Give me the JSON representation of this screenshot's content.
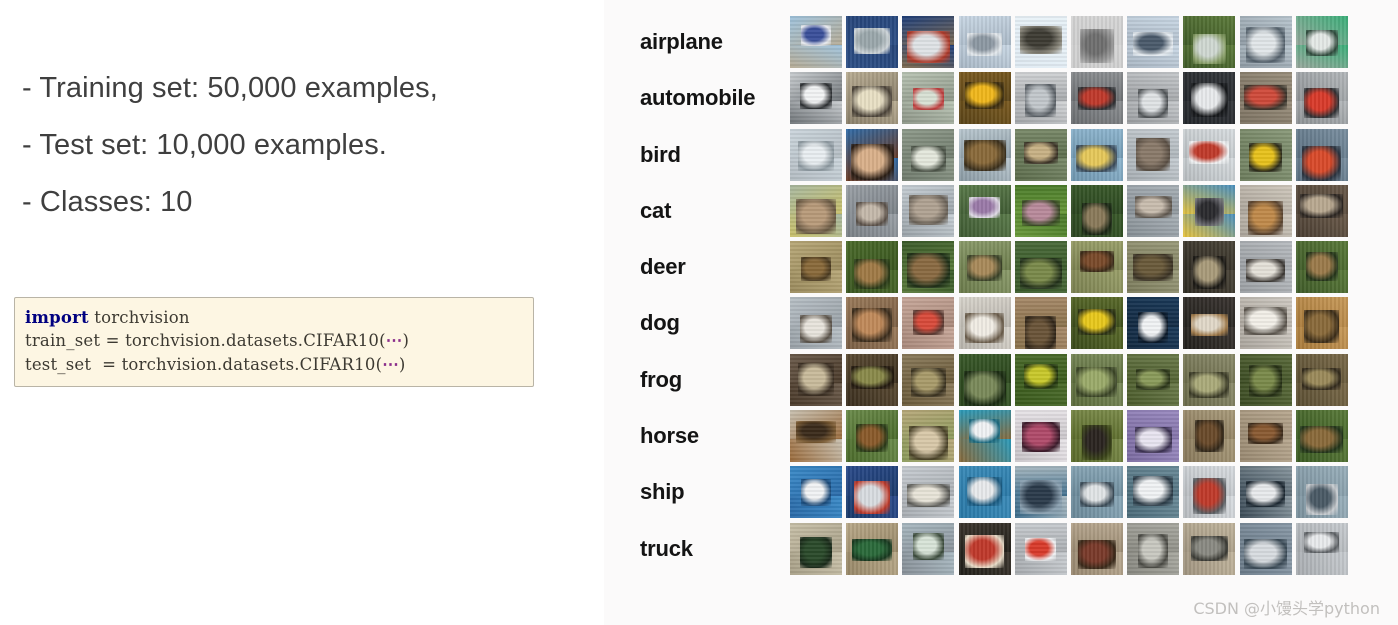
{
  "slide": {
    "bullets": [
      "- Training set: 50,000 examples,",
      "- Test set: 10,000 examples.",
      "- Classes: 10"
    ],
    "code": {
      "line1_keyword": "import",
      "line1_rest": " torchvision",
      "line2_pre": "train_set = torchvision.datasets.CIFAR10(",
      "line2_ellipsis": "⋯",
      "line2_post": ")",
      "line3_pre": "test_set  = torchvision.datasets.CIFAR10(",
      "line3_ellipsis": "⋯",
      "line3_post": ")"
    },
    "watermark": "CSDN @小馒头学python",
    "colors": {
      "text": "#3f3f3f",
      "code_bg": "#fdf6e3",
      "code_border": "#b9b4a6",
      "keyword": "#000080",
      "ellipsis": "#8b2f8b",
      "label": "#141414",
      "panel_bg": "#fbfafa",
      "watermark": "#c2c0be"
    }
  },
  "dataset_grid": {
    "columns": 10,
    "rows": [
      {
        "label": "airplane",
        "thumbs": [
          {
            "sky": "#9fc3dd",
            "ground": "#b6ab94",
            "obj": "#3a4f9a",
            "obj2": "#e8eaee"
          },
          {
            "sky": "#26457a",
            "ground": "#2d4f86",
            "obj": "#9aa7ab",
            "obj2": "#cdd4d8"
          },
          {
            "sky": "#1f3f7a",
            "ground": "#7e6a4e",
            "obj": "#dfe3e6",
            "obj2": "#b03a2a"
          },
          {
            "sky": "#c9d7e4",
            "ground": "#a9b8c6",
            "obj": "#8d98a3",
            "obj2": "#e3e8ec"
          },
          {
            "sky": "#e9f2f8",
            "ground": "#dfeaf2",
            "obj": "#3d3b33",
            "obj2": "#8d8a7e"
          },
          {
            "sky": "#d6d6d6",
            "ground": "#cfcfcf",
            "obj": "#6f6f6f",
            "obj2": "#9a9a9a"
          },
          {
            "sky": "#cbd9e6",
            "ground": "#a8b5c2",
            "obj": "#4a5a6b",
            "obj2": "#e6ecf1"
          },
          {
            "sky": "#5c7a3a",
            "ground": "#3f5a28",
            "obj": "#cfd8d2",
            "obj2": "#8aa06a"
          },
          {
            "sky": "#b9c6cf",
            "ground": "#8e9aa3",
            "obj": "#e1e6e9",
            "obj2": "#55626d"
          },
          {
            "sky": "#3bb07a",
            "ground": "#9aa79d",
            "obj": "#e4e9e6",
            "obj2": "#2f4a3c"
          }
        ]
      },
      {
        "label": "automobile",
        "thumbs": [
          {
            "sky": "#c9cdd0",
            "ground": "#6d7276",
            "obj": "#f2f3f4",
            "obj2": "#2b2e31"
          },
          {
            "sky": "#b8ac92",
            "ground": "#8a7f6a",
            "obj": "#e8dfc4",
            "obj2": "#4a4238"
          },
          {
            "sky": "#b9c4b4",
            "ground": "#8c9486",
            "obj": "#d8e0d4",
            "obj2": "#c03a3a"
          },
          {
            "sky": "#7a5a20",
            "ground": "#5a4418",
            "obj": "#f0b71c",
            "obj2": "#3a2c10"
          },
          {
            "sky": "#d2d4d6",
            "ground": "#a3a6a9",
            "obj": "#c2c7cb",
            "obj2": "#5a6066"
          },
          {
            "sky": "#8c8f92",
            "ground": "#6a6d70",
            "obj": "#c0392b",
            "obj2": "#2e3033"
          },
          {
            "sky": "#c5c8cb",
            "ground": "#9a9da0",
            "obj": "#dfe2e5",
            "obj2": "#4f5356"
          },
          {
            "sky": "#33363a",
            "ground": "#22252a",
            "obj": "#e8eaec",
            "obj2": "#15171a"
          },
          {
            "sky": "#9a8f7c",
            "ground": "#7a7060",
            "obj": "#cf4a3a",
            "obj2": "#3a352c"
          },
          {
            "sky": "#b4b8bb",
            "ground": "#8e9295",
            "obj": "#d93a2a",
            "obj2": "#2f3134"
          }
        ]
      },
      {
        "label": "bird",
        "thumbs": [
          {
            "sky": "#ccd6dd",
            "ground": "#b3bcc2",
            "obj": "#e9eef1",
            "obj2": "#8e9aa1"
          },
          {
            "sky": "#2f6ba8",
            "ground": "#6b3a22",
            "obj": "#d9b08a",
            "obj2": "#2a1d14"
          },
          {
            "sky": "#8e9a8a",
            "ground": "#6f7a6c",
            "obj": "#e4e8dc",
            "obj2": "#4a5246"
          },
          {
            "sky": "#b9c7cf",
            "ground": "#8a9aa3",
            "obj": "#8a6a3a",
            "obj2": "#3a2f1c"
          },
          {
            "sky": "#7a8a6a",
            "ground": "#5a6a4a",
            "obj": "#c7b184",
            "obj2": "#3a3226"
          },
          {
            "sky": "#8fb6cf",
            "ground": "#6f96af",
            "obj": "#e6c85a",
            "obj2": "#3a4a5a"
          },
          {
            "sky": "#c6cdd2",
            "ground": "#a6adb2",
            "obj": "#8a7a6a",
            "obj2": "#5a4f44"
          },
          {
            "sky": "#d8dde0",
            "ground": "#b8bdc0",
            "obj": "#c03a2a",
            "obj2": "#f0f2f3"
          },
          {
            "sky": "#8a9a7a",
            "ground": "#6a7a5a",
            "obj": "#e8c21c",
            "obj2": "#2a2a1a"
          },
          {
            "sky": "#7a8fa0",
            "ground": "#5a6f80",
            "obj": "#d94a2a",
            "obj2": "#2a3440"
          }
        ]
      },
      {
        "label": "cat",
        "thumbs": [
          {
            "sky": "#a8b8a0",
            "ground": "#c9c06a",
            "obj": "#b89a7a",
            "obj2": "#6a5a44"
          },
          {
            "sky": "#9aa0a6",
            "ground": "#7a8086",
            "obj": "#c4b8aa",
            "obj2": "#5a5048"
          },
          {
            "sky": "#c6ced4",
            "ground": "#9aa2a8",
            "obj": "#b0a292",
            "obj2": "#6a6258"
          },
          {
            "sky": "#5a7a4a",
            "ground": "#3f5a33",
            "obj": "#9a7aa8",
            "obj2": "#e0dce6"
          },
          {
            "sky": "#4a7a2a",
            "ground": "#6a9a3a",
            "obj": "#b88a9a",
            "obj2": "#3a4a26"
          },
          {
            "sky": "#3a5a2a",
            "ground": "#2a4420",
            "obj": "#8a7a5a",
            "obj2": "#1a2614"
          },
          {
            "sky": "#a8b0b6",
            "ground": "#868e94",
            "obj": "#c8bcae",
            "obj2": "#5f574e"
          },
          {
            "sky": "#4a90c0",
            "ground": "#e8c23a",
            "obj": "#2a2a2e",
            "obj2": "#6a6a70"
          },
          {
            "sky": "#cfc8bc",
            "ground": "#aaa399",
            "obj": "#c08a4a",
            "obj2": "#5a4430"
          },
          {
            "sky": "#6a5a4a",
            "ground": "#4a3e32",
            "obj": "#b8a890",
            "obj2": "#2a2420"
          }
        ]
      },
      {
        "label": "deer",
        "thumbs": [
          {
            "sky": "#b8a878",
            "ground": "#9a8a5c",
            "obj": "#8a6a3a",
            "obj2": "#4a3a20"
          },
          {
            "sky": "#4a6a2a",
            "ground": "#3a5620",
            "obj": "#a07a46",
            "obj2": "#2a3a18"
          },
          {
            "sky": "#3a5a2a",
            "ground": "#5a7a3a",
            "obj": "#8a6a42",
            "obj2": "#1f3018"
          },
          {
            "sky": "#8a9a6a",
            "ground": "#6a7a4a",
            "obj": "#a88a5a",
            "obj2": "#3a4228"
          },
          {
            "sky": "#4a6a3a",
            "ground": "#3a5a2a",
            "obj": "#7a8a4a",
            "obj2": "#22301a"
          },
          {
            "sky": "#9aa06a",
            "ground": "#7a8050",
            "obj": "#7a4a2a",
            "obj2": "#3a2a18"
          },
          {
            "sky": "#9a9a7a",
            "ground": "#7a7a5a",
            "obj": "#6a5a3a",
            "obj2": "#3a3224"
          },
          {
            "sky": "#4a4438",
            "ground": "#2e2a22",
            "obj": "#a89a7a",
            "obj2": "#1a1814"
          },
          {
            "sky": "#b8bcc0",
            "ground": "#9a9ea2",
            "obj": "#e4e0d8",
            "obj2": "#3a3632"
          },
          {
            "sky": "#5a7a3a",
            "ground": "#3f5a28",
            "obj": "#9a7a4a",
            "obj2": "#24341a"
          }
        ]
      },
      {
        "label": "dog",
        "thumbs": [
          {
            "sky": "#b8c0c6",
            "ground": "#98a0a6",
            "obj": "#e8e4dc",
            "obj2": "#5a5248"
          },
          {
            "sky": "#9a7a5a",
            "ground": "#7a5e44",
            "obj": "#c08a5a",
            "obj2": "#3a2c1c"
          },
          {
            "sky": "#c8a89a",
            "ground": "#a8887a",
            "obj": "#d94a3a",
            "obj2": "#5a3a32"
          },
          {
            "sky": "#d8d4cc",
            "ground": "#b8b4ac",
            "obj": "#f0ece4",
            "obj2": "#6a5c4a"
          },
          {
            "sky": "#a88a6a",
            "ground": "#88704a",
            "obj": "#6a5438",
            "obj2": "#2f2418"
          },
          {
            "sky": "#5a6a2a",
            "ground": "#3a4a1a",
            "obj": "#e8c81c",
            "obj2": "#2a3014"
          },
          {
            "sky": "#1a3a5a",
            "ground": "#12283f",
            "obj": "#f0f2f4",
            "obj2": "#0a1828"
          },
          {
            "sky": "#3a3430",
            "ground": "#22201c",
            "obj": "#e0d8c8",
            "obj2": "#a07a4a"
          },
          {
            "sky": "#cfcac2",
            "ground": "#aaa49c",
            "obj": "#f2efe8",
            "obj2": "#5a544c"
          },
          {
            "sky": "#c89a5a",
            "ground": "#a87a3a",
            "obj": "#8a6a3a",
            "obj2": "#3a2c18"
          }
        ]
      },
      {
        "label": "frog",
        "thumbs": [
          {
            "sky": "#6a5a4a",
            "ground": "#4a3a2a",
            "obj": "#c8ba9a",
            "obj2": "#3a2e22"
          },
          {
            "sky": "#5a4a32",
            "ground": "#3a2e1e",
            "obj": "#8a8a4a",
            "obj2": "#22190f"
          },
          {
            "sky": "#8a7a5a",
            "ground": "#6a5a3a",
            "obj": "#a89a6a",
            "obj2": "#3a3220"
          },
          {
            "sky": "#3a5a2a",
            "ground": "#2a441c",
            "obj": "#7a8a5a",
            "obj2": "#1a2a12"
          },
          {
            "sky": "#4a6a2a",
            "ground": "#3a5a1c",
            "obj": "#c8c82a",
            "obj2": "#22340f"
          },
          {
            "sky": "#7a8a5a",
            "ground": "#5a6a3a",
            "obj": "#9aaa6a",
            "obj2": "#3a4426"
          },
          {
            "sky": "#6a7a4a",
            "ground": "#4a5a2a",
            "obj": "#8a9a5a",
            "obj2": "#2a3418"
          },
          {
            "sky": "#8a8a6a",
            "ground": "#6a6a4a",
            "obj": "#aaaa7a",
            "obj2": "#3a3a26"
          },
          {
            "sky": "#5a6a3a",
            "ground": "#3a4a22",
            "obj": "#7a8a4a",
            "obj2": "#242e14"
          },
          {
            "sky": "#7a6a4a",
            "ground": "#5a4e32",
            "obj": "#9a8a5a",
            "obj2": "#322a1c"
          }
        ]
      },
      {
        "label": "horse",
        "thumbs": [
          {
            "sky": "#c8c0b0",
            "ground": "#9a6a3a",
            "obj": "#3a2a1a",
            "obj2": "#7a5a32"
          },
          {
            "sky": "#6a8a4a",
            "ground": "#4a6a2a",
            "obj": "#8a5a2a",
            "obj2": "#2a3a18"
          },
          {
            "sky": "#b8a87a",
            "ground": "#8a9a5a",
            "obj": "#d8c8a8",
            "obj2": "#4a4228"
          },
          {
            "sky": "#2a9aba",
            "ground": "#8a6a3a",
            "obj": "#f0f2f4",
            "obj2": "#1a6a80"
          },
          {
            "sky": "#e8e4e8",
            "ground": "#c8c4c8",
            "obj": "#b04a6a",
            "obj2": "#3a1a2a"
          },
          {
            "sky": "#7a8a4a",
            "ground": "#5a6a2a",
            "obj": "#2a2420",
            "obj2": "#3a4418"
          },
          {
            "sky": "#9a8ac0",
            "ground": "#7a6aa0",
            "obj": "#e8e4f0",
            "obj2": "#3a3050"
          },
          {
            "sky": "#a89a7a",
            "ground": "#88785a",
            "obj": "#6a4a2a",
            "obj2": "#32281a"
          },
          {
            "sky": "#b8a890",
            "ground": "#988870",
            "obj": "#8a5a32",
            "obj2": "#3a2a1a"
          },
          {
            "sky": "#5a7a3a",
            "ground": "#3a5a22",
            "obj": "#8a6a3a",
            "obj2": "#22341a"
          }
        ]
      },
      {
        "label": "ship",
        "thumbs": [
          {
            "sky": "#3a8ac8",
            "ground": "#2a6aa8",
            "obj": "#f0f2f4",
            "obj2": "#1a4a7a"
          },
          {
            "sky": "#2a4a8a",
            "ground": "#1a3a6a",
            "obj": "#d8dce0",
            "obj2": "#c03a2a"
          },
          {
            "sky": "#c8cdd2",
            "ground": "#a8adb2",
            "obj": "#e8e4d8",
            "obj2": "#5a5a56"
          },
          {
            "sky": "#3a8ab8",
            "ground": "#2a7aa8",
            "obj": "#e8eaec",
            "obj2": "#1a5a80"
          },
          {
            "sky": "#a8b8c0",
            "ground": "#3a6a8a",
            "obj": "#2a3a4a",
            "obj2": "#8aa0b0"
          },
          {
            "sky": "#8aa8b8",
            "ground": "#6a8898",
            "obj": "#e0e4e6",
            "obj2": "#3a4a56"
          },
          {
            "sky": "#6a8a98",
            "ground": "#4a6a78",
            "obj": "#f0f2f4",
            "obj2": "#2a3a46"
          },
          {
            "sky": "#d8dce0",
            "ground": "#b8bcc0",
            "obj": "#c03a2a",
            "obj2": "#5a5e62"
          },
          {
            "sky": "#8a98a0",
            "ground": "#3a4a56",
            "obj": "#e8eaec",
            "obj2": "#1a2630"
          },
          {
            "sky": "#9ab0bc",
            "ground": "#7a909c",
            "obj": "#4a5a66",
            "obj2": "#c8ccd0"
          }
        ]
      },
      {
        "label": "truck",
        "thumbs": [
          {
            "sky": "#c8c0a8",
            "ground": "#a8a088",
            "obj": "#2a4a2a",
            "obj2": "#1a2a1a"
          },
          {
            "sky": "#b8a888",
            "ground": "#988868",
            "obj": "#2a6a3a",
            "obj2": "#18381f"
          },
          {
            "sky": "#a8b8c0",
            "ground": "#889098",
            "obj": "#d8e4d8",
            "obj2": "#3a4a3a"
          },
          {
            "sky": "#3a342c",
            "ground": "#22201a",
            "obj": "#c0392b",
            "obj2": "#e8dcc8"
          },
          {
            "sky": "#c8ccd0",
            "ground": "#a8acb0",
            "obj": "#d93a2a",
            "obj2": "#f0f2f4"
          },
          {
            "sky": "#b8a890",
            "ground": "#988870",
            "obj": "#7a3a2a",
            "obj2": "#3a2a1a"
          },
          {
            "sky": "#a8a8a0",
            "ground": "#888880",
            "obj": "#c8c8c0",
            "obj2": "#4a4a44"
          },
          {
            "sky": "#c0b49c",
            "ground": "#a09480",
            "obj": "#8a8a82",
            "obj2": "#3a3a34"
          },
          {
            "sky": "#8a9aa8",
            "ground": "#6a7a88",
            "obj": "#d8dce0",
            "obj2": "#3a4a56"
          },
          {
            "sky": "#c8ccd0",
            "ground": "#a8acb0",
            "obj": "#e8eaec",
            "obj2": "#5a5e62"
          }
        ]
      }
    ]
  }
}
